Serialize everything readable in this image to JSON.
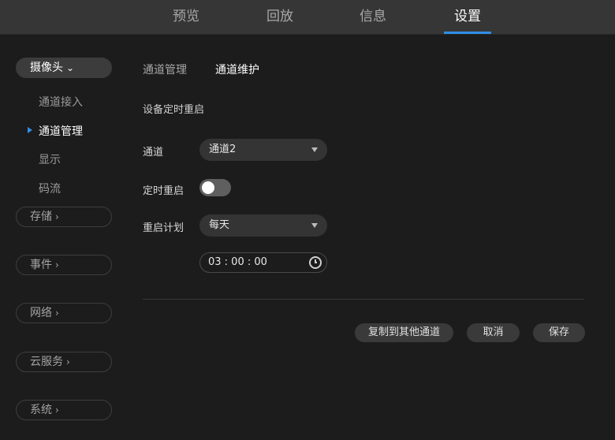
{
  "nav": {
    "tabs": [
      {
        "label": "预览"
      },
      {
        "label": "回放"
      },
      {
        "label": "信息"
      },
      {
        "label": "设置"
      }
    ],
    "active": "设置"
  },
  "sidebar": {
    "camera": {
      "label": "摄像头",
      "chevron": "⌄"
    },
    "camera_items": [
      {
        "label": "通道接入"
      },
      {
        "label": "通道管理"
      },
      {
        "label": "显示"
      },
      {
        "label": "码流"
      }
    ],
    "active_item": "通道管理",
    "groups": [
      {
        "label": "存储",
        "chevron": "›"
      },
      {
        "label": "事件",
        "chevron": "›"
      },
      {
        "label": "网络",
        "chevron": "›"
      },
      {
        "label": "云服务",
        "chevron": "›"
      },
      {
        "label": "系统",
        "chevron": "›"
      }
    ]
  },
  "main": {
    "subtabs": [
      {
        "label": "通道管理"
      },
      {
        "label": "通道维护"
      }
    ],
    "active_subtab": "通道维护",
    "section_title": "设备定时重启",
    "channel": {
      "label": "通道",
      "value": "通道2"
    },
    "scheduled_reboot": {
      "label": "定时重启",
      "enabled": false
    },
    "reboot_plan": {
      "label": "重启计划",
      "value": "每天"
    },
    "time": {
      "value": "03 : 00 : 00",
      "icon": "clock-icon"
    }
  },
  "buttons": {
    "copy": "复制到其他通道",
    "cancel": "取消",
    "save": "保存"
  },
  "colors": {
    "accent": "#2f8ee5",
    "topbar": "#363636",
    "background": "#1c1c1c"
  }
}
